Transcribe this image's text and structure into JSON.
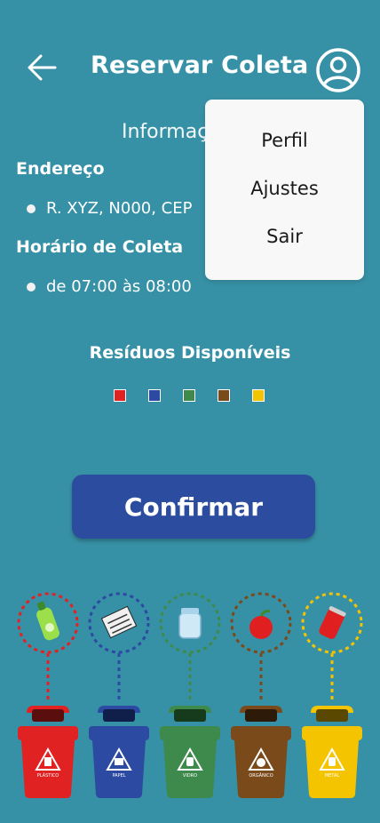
{
  "header": {
    "title": "Reservar Coleta",
    "back_icon": "arrow-left-icon",
    "profile_icon": "user-circle-icon"
  },
  "info": {
    "heading": "Informações",
    "address_label": "Endereço",
    "address_value": "R. XYZ, N000, CEP",
    "schedule_label": "Horário de Coleta",
    "schedule_value": "de 07:00 às 08:00"
  },
  "dropdown": {
    "items": [
      {
        "label": "Perfil"
      },
      {
        "label": "Ajustes"
      },
      {
        "label": "Sair"
      }
    ]
  },
  "residuos": {
    "title": "Resíduos Disponíveis",
    "colors": [
      "#e02222",
      "#2c4aa1",
      "#3e8a4d",
      "#7a4a1a",
      "#f5c400"
    ]
  },
  "confirm_label": "Confirmar",
  "bins": [
    {
      "label": "PLÁSTICO",
      "color": "#e02222",
      "icon": "bottle-icon"
    },
    {
      "label": "PAPEL",
      "color": "#2c4aa1",
      "icon": "newspaper-icon"
    },
    {
      "label": "VIDRO",
      "color": "#3e8a4d",
      "icon": "jar-icon"
    },
    {
      "label": "ORGÂNICO",
      "color": "#7a4a1a",
      "icon": "apple-icon"
    },
    {
      "label": "METAL",
      "color": "#f5c400",
      "icon": "can-icon"
    }
  ]
}
